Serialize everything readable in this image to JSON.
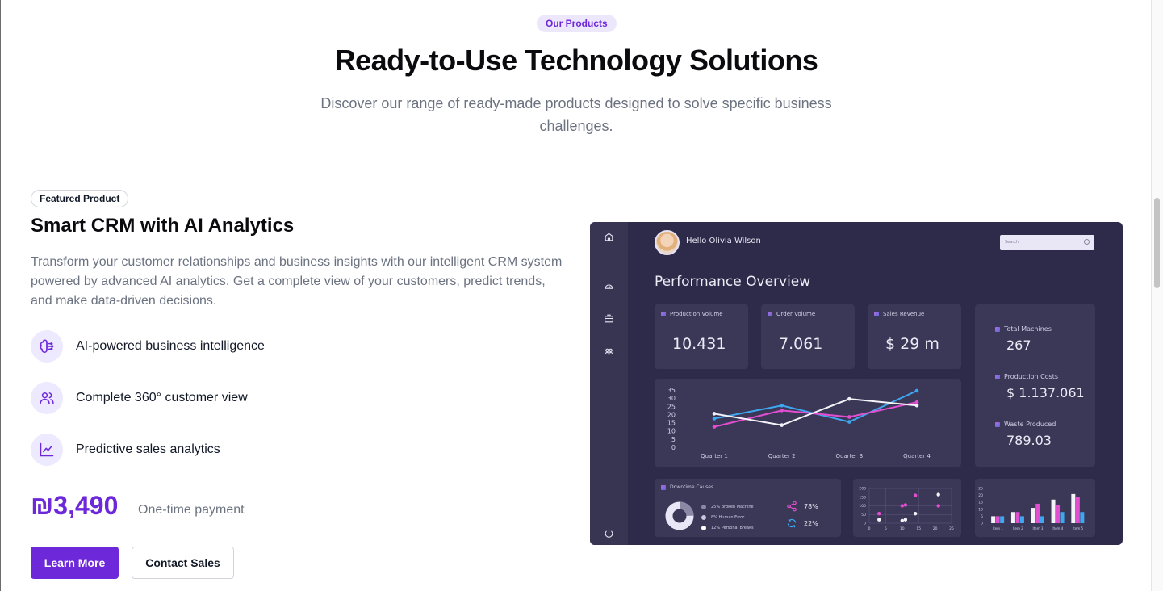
{
  "header": {
    "eyebrow": "Our Products",
    "title": "Ready-to-Use Technology Solutions",
    "subtitle": "Discover our range of ready-made products designed to solve specific business challenges."
  },
  "product": {
    "badge": "Featured Product",
    "name": "Smart CRM with AI Analytics",
    "description": "Transform your customer relationships and business insights with our intelligent CRM system powered by advanced AI analytics. Get a complete view of your customers, predict trends, and make data-driven decisions.",
    "features": [
      {
        "icon": "brain-circuit-icon",
        "label": "AI-powered business intelligence"
      },
      {
        "icon": "users-icon",
        "label": "Complete 360° customer view"
      },
      {
        "icon": "line-chart-icon",
        "label": "Predictive sales analytics"
      }
    ],
    "price": "₪3,490",
    "price_note": "One-time payment",
    "learn_more": "Learn More",
    "contact_sales": "Contact Sales"
  },
  "dashboard": {
    "greeting": "Hello Olivia Wilson",
    "search_placeholder": "Search",
    "title": "Performance Overview",
    "kpis": [
      {
        "label": "Production Volume",
        "value": "10.431"
      },
      {
        "label": "Order Volume",
        "value": "7.061"
      },
      {
        "label": "Sales Revenue",
        "value": "$ 29 m"
      }
    ],
    "side_stats": [
      {
        "label": "Total Machines",
        "value": "267"
      },
      {
        "label": "Production Costs",
        "value": "$ 1.137.061"
      },
      {
        "label": "Waste Produced",
        "value": "789.03"
      }
    ],
    "downtime": {
      "title": "Downtime Causes",
      "items": [
        "25% Broken Machine",
        "8% Human Error",
        "12% Personal Breaks"
      ],
      "share_pct": "78%",
      "sync_pct": "22%"
    },
    "colors": {
      "blue": "#3fa7f0",
      "pink": "#e14fd0",
      "white": "#f4f4f8"
    }
  },
  "chart_data": [
    {
      "type": "line",
      "categories": [
        "Quarter 1",
        "Quarter 2",
        "Quarter 3",
        "Quarter 4"
      ],
      "y_ticks": [
        "35",
        "30",
        "25",
        "20",
        "15",
        "10",
        "5",
        "0"
      ],
      "ylim": [
        0,
        35
      ],
      "series": [
        {
          "values": [
            18,
            26,
            16,
            35
          ],
          "color": "#3fa7f0"
        },
        {
          "values": [
            13,
            23,
            19,
            28
          ],
          "color": "#e14fd0"
        },
        {
          "values": [
            21,
            14,
            30,
            26
          ],
          "color": "#f4f4f8"
        }
      ]
    },
    {
      "type": "scatter",
      "x_ticks": [
        "0",
        "5",
        "10",
        "15",
        "20",
        "25"
      ],
      "y_ticks": [
        "200",
        "150",
        "100",
        "50",
        "0"
      ],
      "xlim": [
        0,
        25
      ],
      "ylim": [
        0,
        200
      ],
      "series": [
        {
          "points": [
            [
              3,
              55
            ],
            [
              10,
              100
            ],
            [
              11,
              105
            ],
            [
              14,
              160
            ],
            [
              21,
              100
            ]
          ],
          "color": "#e14fd0"
        },
        {
          "points": [
            [
              3,
              20
            ],
            [
              10,
              15
            ],
            [
              11,
              20
            ],
            [
              14,
              55
            ],
            [
              21,
              165
            ]
          ],
          "color": "#f4f4f8"
        }
      ]
    },
    {
      "type": "bar",
      "categories": [
        "Item 1",
        "Item 2",
        "Item 3",
        "Item 4",
        "Item 5"
      ],
      "y_ticks": [
        "25",
        "20",
        "15",
        "10",
        "5",
        "0"
      ],
      "ylim": [
        0,
        25
      ],
      "series": [
        {
          "values": [
            5,
            8,
            11,
            17,
            21
          ],
          "color": "#f4f4f8"
        },
        {
          "values": [
            5,
            8,
            14,
            13,
            19
          ],
          "color": "#e14fd0"
        },
        {
          "values": [
            5,
            5,
            5,
            8,
            8
          ],
          "color": "#3fa7f0"
        }
      ]
    }
  ]
}
